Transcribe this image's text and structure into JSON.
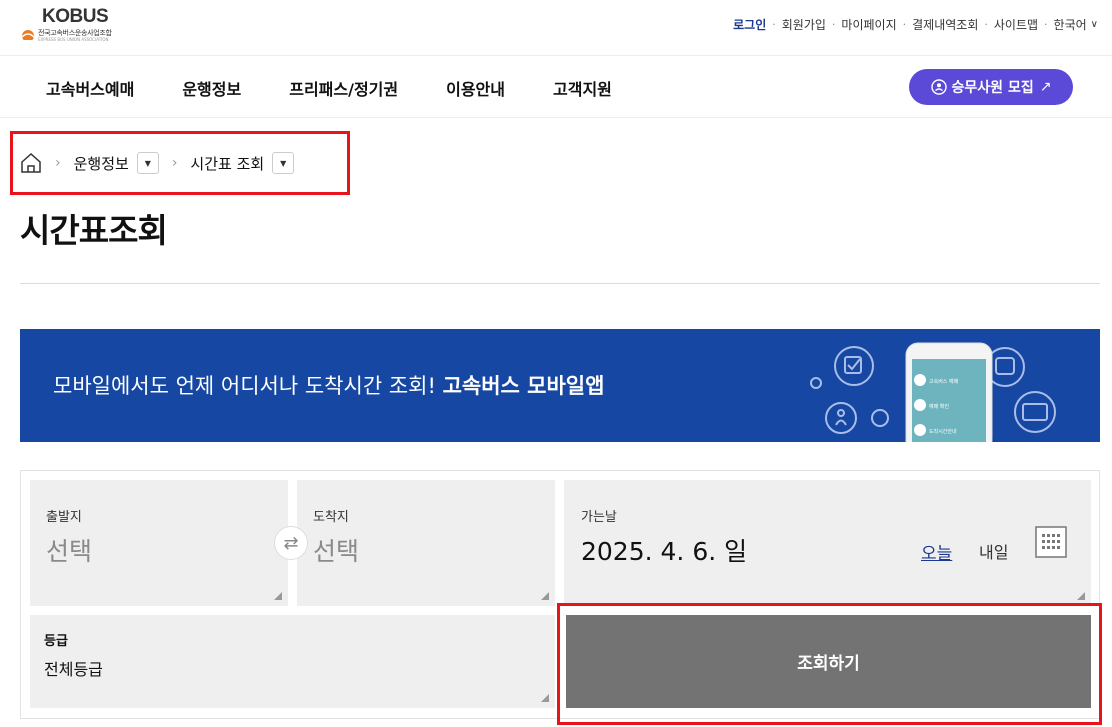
{
  "brand": {
    "logo_text": "KOBUS",
    "logo_sub": "전국고속버스운송사업조합",
    "logo_sub_en": "EXPRESS BUS UNION ASSOCIATION"
  },
  "util_nav": {
    "items": [
      "로그인",
      "회원가입",
      "마이페이지",
      "결제내역조회",
      "사이트맵",
      "한국어"
    ]
  },
  "main_nav": {
    "items": [
      "고속버스예매",
      "운행정보",
      "프리패스/정기권",
      "이용안내",
      "고객지원"
    ],
    "recruit_label": "승무사원 모집",
    "recruit_color": "#5b4ad8"
  },
  "breadcrumb": {
    "level1": "운행정보",
    "level2": "시간표 조회"
  },
  "page_title": "시간표조회",
  "banner": {
    "text": "모바일에서도 언제 어디서나 도착시간 조회!",
    "highlight": "고속버스 모바일앱",
    "bg_color": "#1547a3",
    "phone_menu": [
      "고속버스 예매",
      "예매 확인",
      "도착시간안내"
    ]
  },
  "search": {
    "departure_label": "출발지",
    "departure_value": "선택",
    "arrival_label": "도착지",
    "arrival_value": "선택",
    "date_label": "가는날",
    "date_value": "2025. 4. 6. 일",
    "today_label": "오늘",
    "tomorrow_label": "내일",
    "grade_label": "등급",
    "grade_value": "전체등급",
    "submit_label": "조회하기"
  },
  "highlight_color": "#e8141c"
}
